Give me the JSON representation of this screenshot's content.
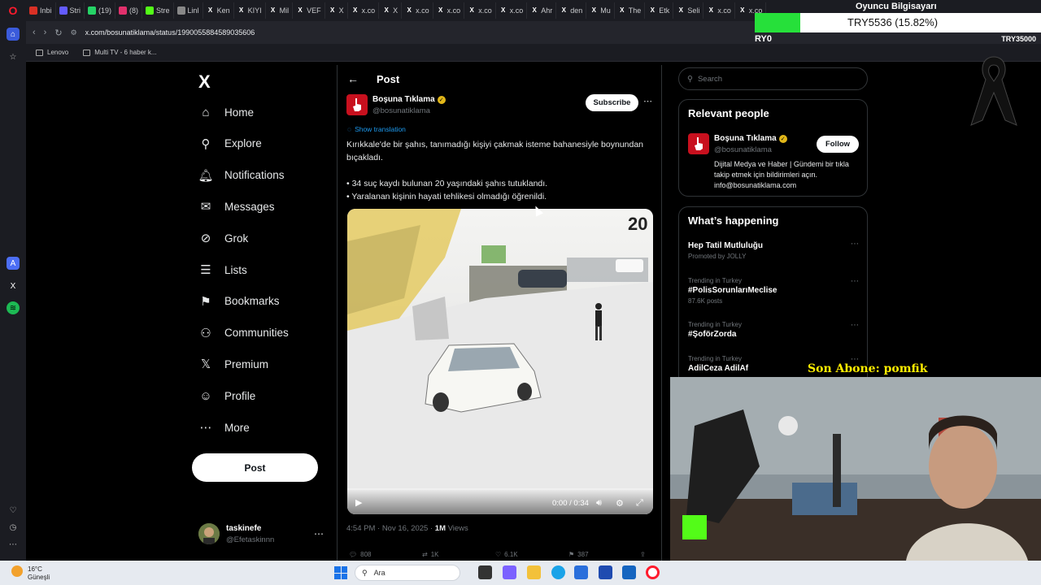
{
  "browser": {
    "tabs": [
      {
        "label": "Inbi",
        "icon": "gmail-icon",
        "color": "#d93025"
      },
      {
        "label": "Stri",
        "icon": "stripe-icon",
        "color": "#635bff"
      },
      {
        "label": "(19)",
        "icon": "chat-icon",
        "color": "#25d366"
      },
      {
        "label": "(8)",
        "icon": "instagram-icon",
        "color": "#e1306c"
      },
      {
        "label": "Stre",
        "icon": "kick-icon",
        "color": "#53fc18"
      },
      {
        "label": "Linl",
        "icon": "link-icon",
        "color": "#888888"
      },
      {
        "label": "Ken",
        "icon": "x-icon",
        "color": "#ffffff"
      },
      {
        "label": "KIYI",
        "icon": "x-icon",
        "color": "#ffffff"
      },
      {
        "label": "Mil",
        "icon": "x-icon",
        "color": "#ffffff"
      },
      {
        "label": "VEF",
        "icon": "x-icon",
        "color": "#ffffff"
      },
      {
        "label": "X",
        "icon": "x-icon",
        "color": "#ffffff"
      },
      {
        "label": "x.co",
        "icon": "x-icon",
        "color": "#ffffff"
      },
      {
        "label": "X",
        "icon": "x-icon",
        "color": "#ffffff"
      },
      {
        "label": "x.co",
        "icon": "x-icon",
        "color": "#ffffff"
      },
      {
        "label": "x.co",
        "icon": "x-icon",
        "color": "#ffffff"
      },
      {
        "label": "x.co",
        "icon": "x-icon",
        "color": "#ffffff"
      },
      {
        "label": "x.co",
        "icon": "x-icon",
        "color": "#ffffff"
      },
      {
        "label": "Ahr",
        "icon": "x-icon",
        "color": "#ffffff"
      },
      {
        "label": "den",
        "icon": "x-icon",
        "color": "#ffffff"
      },
      {
        "label": "Mu",
        "icon": "x-icon",
        "color": "#ffffff"
      },
      {
        "label": "The",
        "icon": "x-icon",
        "color": "#ffffff"
      },
      {
        "label": "Etk",
        "icon": "x-icon",
        "color": "#ffffff"
      },
      {
        "label": "Seli",
        "icon": "x-icon",
        "color": "#ffffff"
      },
      {
        "label": "x.co",
        "icon": "x-icon",
        "color": "#ffffff"
      },
      {
        "label": "x.co",
        "icon": "x-icon",
        "color": "#ffffff"
      }
    ],
    "url": "x.com/bosunatiklama/status/1990055884589035606",
    "bookmarks": [
      {
        "label": "Lenovo",
        "icon": "folder-icon"
      },
      {
        "label": "Multi TV - 6 haber k...",
        "icon": "bookmark-page-icon"
      }
    ]
  },
  "overlay": {
    "goal_title": "Oyuncu Bilgisayarı",
    "goal_text": "TRY5536 (15.82%)",
    "goal_start": "RY0",
    "goal_end": "TRY35000",
    "goal_progress": 0.1582,
    "goal_color": "#26e03a",
    "son_abone": "Son Abone: pomfik"
  },
  "nav": {
    "logo": "X",
    "items": [
      {
        "label": "Home",
        "icon": "home-icon",
        "glyph": "⌂"
      },
      {
        "label": "Explore",
        "icon": "search-icon",
        "glyph": "⚲"
      },
      {
        "label": "Notifications",
        "icon": "bell-icon",
        "glyph": "🔔︎"
      },
      {
        "label": "Messages",
        "icon": "envelope-icon",
        "glyph": "✉"
      },
      {
        "label": "Grok",
        "icon": "grok-icon",
        "glyph": "⊘"
      },
      {
        "label": "Lists",
        "icon": "list-icon",
        "glyph": "☰"
      },
      {
        "label": "Bookmarks",
        "icon": "bookmark-icon",
        "glyph": "⚑"
      },
      {
        "label": "Communities",
        "icon": "people-icon",
        "glyph": "⚇"
      },
      {
        "label": "Premium",
        "icon": "x-premium-icon",
        "glyph": "𝕏"
      },
      {
        "label": "Profile",
        "icon": "person-icon",
        "glyph": "☺"
      },
      {
        "label": "More",
        "icon": "more-circle-icon",
        "glyph": "⋯"
      }
    ],
    "post_button": "Post",
    "account": {
      "name": "taskinefe",
      "handle": "@Efetaskinnn"
    }
  },
  "post": {
    "header_title": "Post",
    "author": {
      "name": "Boşuna Tıklama",
      "handle": "@bosunatiklama"
    },
    "subscribe": "Subscribe",
    "show_translation": "Show translation",
    "text_lines": [
      "Kırıkkale'de bir şahıs, tanımadığı kişiyi çakmak isteme bahanesiyle boynundan bıçakladı.",
      "• 34 suç kaydı bulunan 20 yaşındaki şahıs tutuklandı.",
      "• Yaralanan kişinin hayati tehlikesi olmadığı öğrenildi."
    ],
    "video": {
      "time": "0:00 / 0:34",
      "overlay_number": "20"
    },
    "meta": {
      "time": "4:54 PM · Nov 16, 2025 · ",
      "views": "1M",
      "views_label": " Views"
    },
    "actions": {
      "replies": "808",
      "reposts": "1K",
      "likes": "6.1K",
      "bookmarks": "387"
    }
  },
  "right": {
    "search_placeholder": "Search",
    "relevant": {
      "title": "Relevant people",
      "name": "Boşuna Tıklama",
      "handle": "@bosunatiklama",
      "follow": "Follow",
      "bio": "Dijital Medya ve Haber | Gündemi bir tıkla takip etmek için bildirimleri açın. info@bosunatiklama.com"
    },
    "happening": {
      "title": "What’s happening",
      "trends": [
        {
          "context": "",
          "name": "Hep Tatil Mutluluğu",
          "sub": "Promoted by JOLLY"
        },
        {
          "context": "Trending in Turkey",
          "name": "#PolisSorunlarıMeclise",
          "sub": "87.6K posts"
        },
        {
          "context": "Trending in Turkey",
          "name": "#ŞoförZorda",
          "sub": ""
        },
        {
          "context": "Trending in Turkey",
          "name": "AdilCeza AdilAf",
          "sub": ""
        }
      ]
    }
  },
  "taskbar": {
    "weather_temp": "16°C",
    "weather_desc": "Güneşli",
    "search_placeholder": "Ara"
  }
}
